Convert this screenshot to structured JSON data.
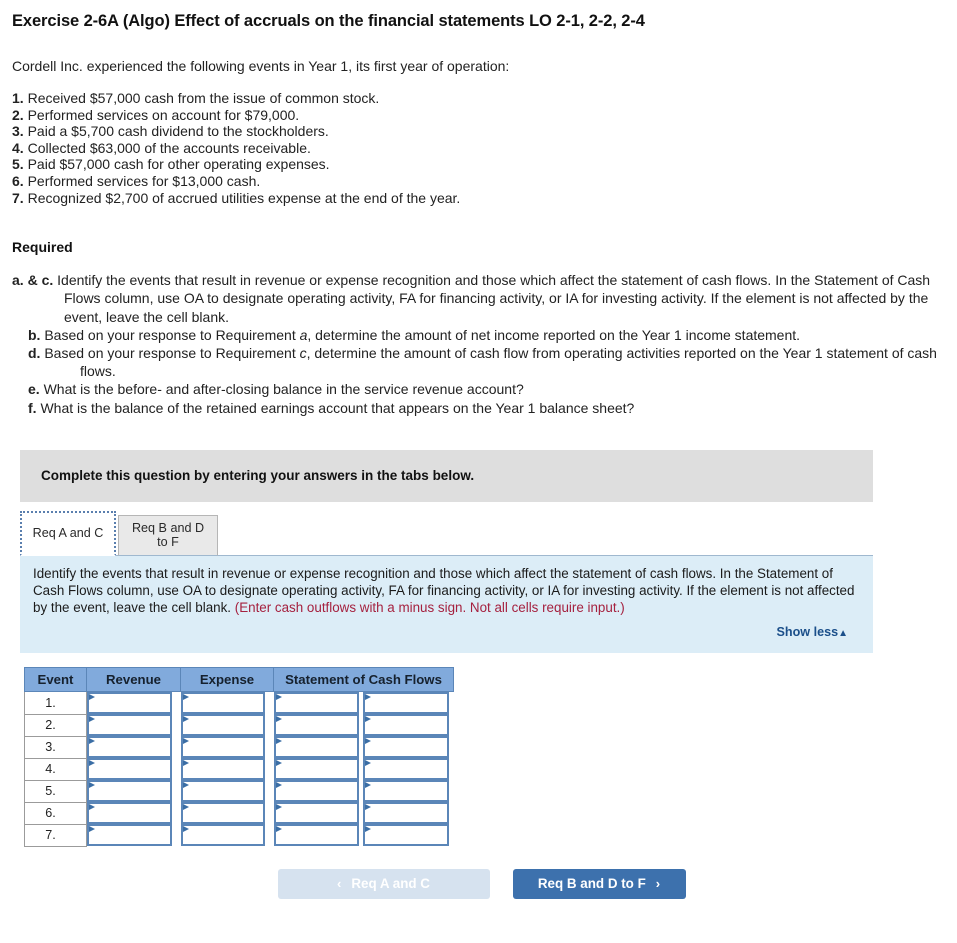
{
  "exercise": {
    "title": "Exercise 2-6A (Algo) Effect of accruals on the financial statements LO 2-1, 2-2, 2-4",
    "intro": "Cordell Inc. experienced the following events in Year 1, its first year of operation:"
  },
  "events": [
    {
      "num": "1.",
      "text": "Received $57,000 cash from the issue of common stock."
    },
    {
      "num": "2.",
      "text": "Performed services on account for $79,000."
    },
    {
      "num": "3.",
      "text": "Paid a $5,700 cash dividend to the stockholders."
    },
    {
      "num": "4.",
      "text": "Collected $63,000 of the accounts receivable."
    },
    {
      "num": "5.",
      "text": "Paid $57,000 cash for other operating expenses."
    },
    {
      "num": "6.",
      "text": "Performed services for $13,000 cash."
    },
    {
      "num": "7.",
      "text": "Recognized $2,700 of accrued utilities expense at the end of the year."
    }
  ],
  "required": {
    "heading": "Required",
    "items": [
      {
        "label": "a. & c.",
        "text": "Identify the events that result in revenue or expense recognition and those which affect the statement of cash flows. In the Statement of Cash Flows column, use OA to designate operating activity, FA for financing activity, or IA for investing activity. If the element is not affected by the event, leave the cell blank."
      },
      {
        "label": "b.",
        "text_before": "Based on your response to Requirement ",
        "italic": "a",
        "text_after": ", determine the amount of net income reported on the Year 1 income statement."
      },
      {
        "label": "d.",
        "text_before": "Based on your response to Requirement ",
        "italic": "c",
        "text_after": ", determine the amount of cash flow from operating activities reported on the Year 1 statement of cash flows."
      },
      {
        "label": "e.",
        "text": "What is the before- and after-closing balance in the service revenue account?"
      },
      {
        "label": "f.",
        "text": "What is the balance of the retained earnings account that appears on the Year 1 balance sheet?"
      }
    ]
  },
  "banner": {
    "text": "Complete this question by entering your answers in the tabs below."
  },
  "tabs": [
    {
      "label": "Req A and C",
      "active": true
    },
    {
      "label": "Req B and D to F",
      "active": false
    }
  ],
  "info_panel": {
    "text": "Identify the events that result in revenue or expense recognition and those which affect the statement of cash flows. In the Statement of Cash Flows column, use OA to designate operating activity, FA for financing activity, or IA for investing activity. If the element is not affected by the event, leave the cell blank. ",
    "note": "(Enter cash outflows with a minus sign. Not all cells require input.)",
    "show_less": "Show less",
    "show_less_caret": "▲"
  },
  "table": {
    "headers": [
      "Event",
      "Revenue",
      "Expense",
      "Statement of Cash Flows"
    ],
    "rows": [
      {
        "event": "1.",
        "revenue": "",
        "expense": "",
        "scf_amount": "",
        "scf_activity": ""
      },
      {
        "event": "2.",
        "revenue": "",
        "expense": "",
        "scf_amount": "",
        "scf_activity": ""
      },
      {
        "event": "3.",
        "revenue": "",
        "expense": "",
        "scf_amount": "",
        "scf_activity": ""
      },
      {
        "event": "4.",
        "revenue": "",
        "expense": "",
        "scf_amount": "",
        "scf_activity": ""
      },
      {
        "event": "5.",
        "revenue": "",
        "expense": "",
        "scf_amount": "",
        "scf_activity": ""
      },
      {
        "event": "6.",
        "revenue": "",
        "expense": "",
        "scf_amount": "",
        "scf_activity": ""
      },
      {
        "event": "7.",
        "revenue": "",
        "expense": "",
        "scf_amount": "",
        "scf_activity": ""
      }
    ]
  },
  "footer": {
    "prev_label": "Req A and C",
    "prev_chevron": "‹",
    "next_label": "Req B and D to F",
    "next_chevron": "›"
  },
  "colors": {
    "header_blue": "#81aadc",
    "cell_border_blue": "#5b86b8",
    "panel_blue": "#dcedf7",
    "banner_gray": "#dedede",
    "button_blue": "#3d71ad",
    "button_disabled": "#d6e2ef",
    "note_red": "#a5213f",
    "link_blue": "#1b4f8a"
  }
}
